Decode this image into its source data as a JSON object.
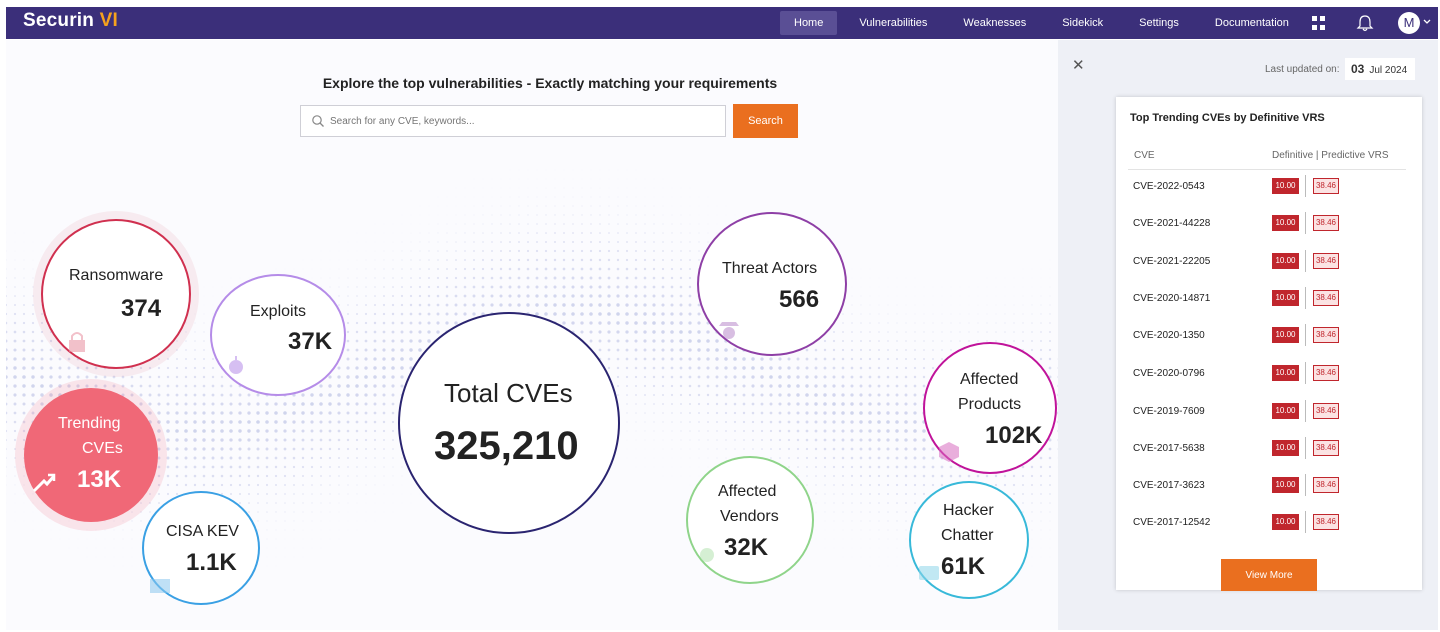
{
  "brand": {
    "name": "Securin",
    "suffix": "VI"
  },
  "nav": {
    "links": [
      "Home",
      "Vulnerabilities",
      "Weaknesses",
      "Sidekick",
      "Settings",
      "Documentation"
    ],
    "active": "Home",
    "avatar_initial": "M"
  },
  "hero": {
    "tagline": "Explore the top vulnerabilities - Exactly matching your requirements",
    "search_placeholder": "Search for any CVE, keywords...",
    "search_button": "Search"
  },
  "stats": {
    "ransomware": {
      "label": "Ransomware",
      "value": "374"
    },
    "exploits": {
      "label": "Exploits",
      "value": "37K"
    },
    "trending": {
      "label1": "Trending",
      "label2": "CVEs",
      "value": "13K"
    },
    "cisa_kev": {
      "label": "CISA KEV",
      "value": "1.1K"
    },
    "total": {
      "label": "Total CVEs",
      "value": "325,210"
    },
    "threat_actors": {
      "label": "Threat Actors",
      "value": "566"
    },
    "affected_products": {
      "label1": "Affected",
      "label2": "Products",
      "value": "102K"
    },
    "affected_vendors": {
      "label1": "Affected",
      "label2": "Vendors",
      "value": "32K"
    },
    "hacker_chatter": {
      "label1": "Hacker",
      "label2": "Chatter",
      "value": "61K"
    }
  },
  "colors": {
    "nav_bg": "#3b2f7a",
    "accent_orange": "#ea6f1f",
    "ransomware": "#d0304f",
    "exploits": "#b58ce8",
    "trending": "#f06877",
    "cisa_kev": "#3aa0e4",
    "total": "#2a2470",
    "threat_actors": "#8e3fa6",
    "affected_products": "#c0139a",
    "affected_vendors": "#8fd48a",
    "hacker_chatter": "#38b9d9",
    "vrs_red": "#c0262d"
  },
  "panel": {
    "close_icon": "close-icon",
    "updated_label": "Last updated on:",
    "updated_day": "03",
    "updated_month_year": "Jul 2024",
    "card_title": "Top Trending CVEs by Definitive VRS",
    "col_cve": "CVE",
    "col_vrs": "Definitive | Predictive VRS",
    "rows": [
      {
        "cve": "CVE-2022-0543",
        "definitive": "10.00",
        "predictive": "38.46"
      },
      {
        "cve": "CVE-2021-44228",
        "definitive": "10.00",
        "predictive": "38.46"
      },
      {
        "cve": "CVE-2021-22205",
        "definitive": "10.00",
        "predictive": "38.46"
      },
      {
        "cve": "CVE-2020-14871",
        "definitive": "10.00",
        "predictive": "38.46"
      },
      {
        "cve": "CVE-2020-1350",
        "definitive": "10.00",
        "predictive": "38.46"
      },
      {
        "cve": "CVE-2020-0796",
        "definitive": "10.00",
        "predictive": "38.46"
      },
      {
        "cve": "CVE-2019-7609",
        "definitive": "10.00",
        "predictive": "38.46"
      },
      {
        "cve": "CVE-2017-5638",
        "definitive": "10.00",
        "predictive": "38.46"
      },
      {
        "cve": "CVE-2017-3623",
        "definitive": "10.00",
        "predictive": "38.46"
      },
      {
        "cve": "CVE-2017-12542",
        "definitive": "10.00",
        "predictive": "38.46"
      }
    ],
    "view_more": "View More"
  }
}
